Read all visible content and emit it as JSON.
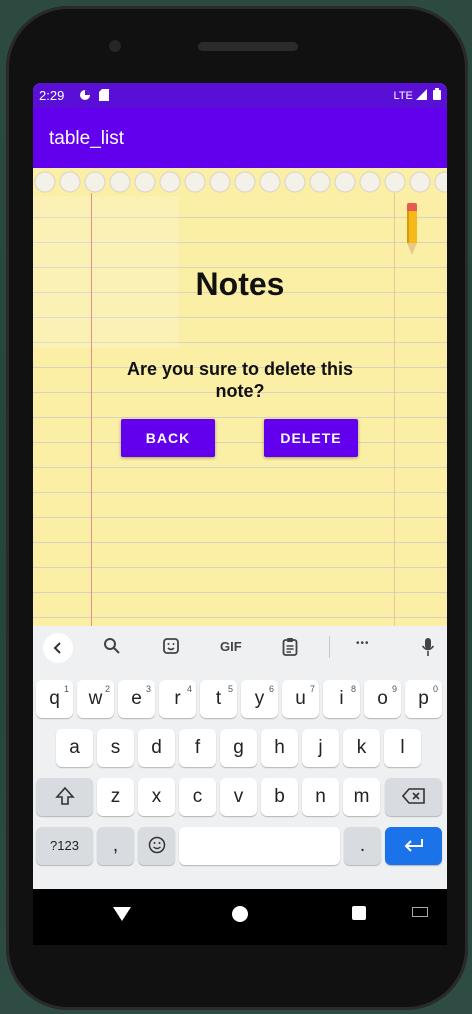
{
  "status_bar": {
    "time": "2:29",
    "network": "LTE"
  },
  "app_bar": {
    "title": "table_list"
  },
  "content": {
    "heading": "Notes",
    "question": "Are you sure to delete this note?",
    "back_label": "BACK",
    "delete_label": "DELETE"
  },
  "keyboard": {
    "suggestion_gif": "GIF",
    "suggestion_more": "•••",
    "row1": [
      {
        "key": "q",
        "hint": "1"
      },
      {
        "key": "w",
        "hint": "2"
      },
      {
        "key": "e",
        "hint": "3"
      },
      {
        "key": "r",
        "hint": "4"
      },
      {
        "key": "t",
        "hint": "5"
      },
      {
        "key": "y",
        "hint": "6"
      },
      {
        "key": "u",
        "hint": "7"
      },
      {
        "key": "i",
        "hint": "8"
      },
      {
        "key": "o",
        "hint": "9"
      },
      {
        "key": "p",
        "hint": "0"
      }
    ],
    "row2": [
      "a",
      "s",
      "d",
      "f",
      "g",
      "h",
      "j",
      "k",
      "l"
    ],
    "row3": [
      "z",
      "x",
      "c",
      "v",
      "b",
      "n",
      "m"
    ],
    "symbols_label": "?123",
    "comma_label": ",",
    "period_label": "."
  },
  "colors": {
    "primary": "#6200ee",
    "status_bar": "#5a0fd6",
    "keyboard_action": "#1a73e8",
    "paper": "#fbeea5"
  },
  "icons": {
    "status": [
      "data-saver-icon",
      "sd-card-icon",
      "signal-icon",
      "battery-icon"
    ],
    "keyboard": [
      "chevron-left-icon",
      "search-icon",
      "sticker-icon",
      "gif-icon",
      "clipboard-icon",
      "more-icon",
      "mic-icon",
      "shift-icon",
      "backspace-icon",
      "emoji-icon",
      "enter-icon"
    ],
    "nav": [
      "back-icon",
      "home-icon",
      "recents-icon",
      "keyboard-switch-icon"
    ]
  }
}
